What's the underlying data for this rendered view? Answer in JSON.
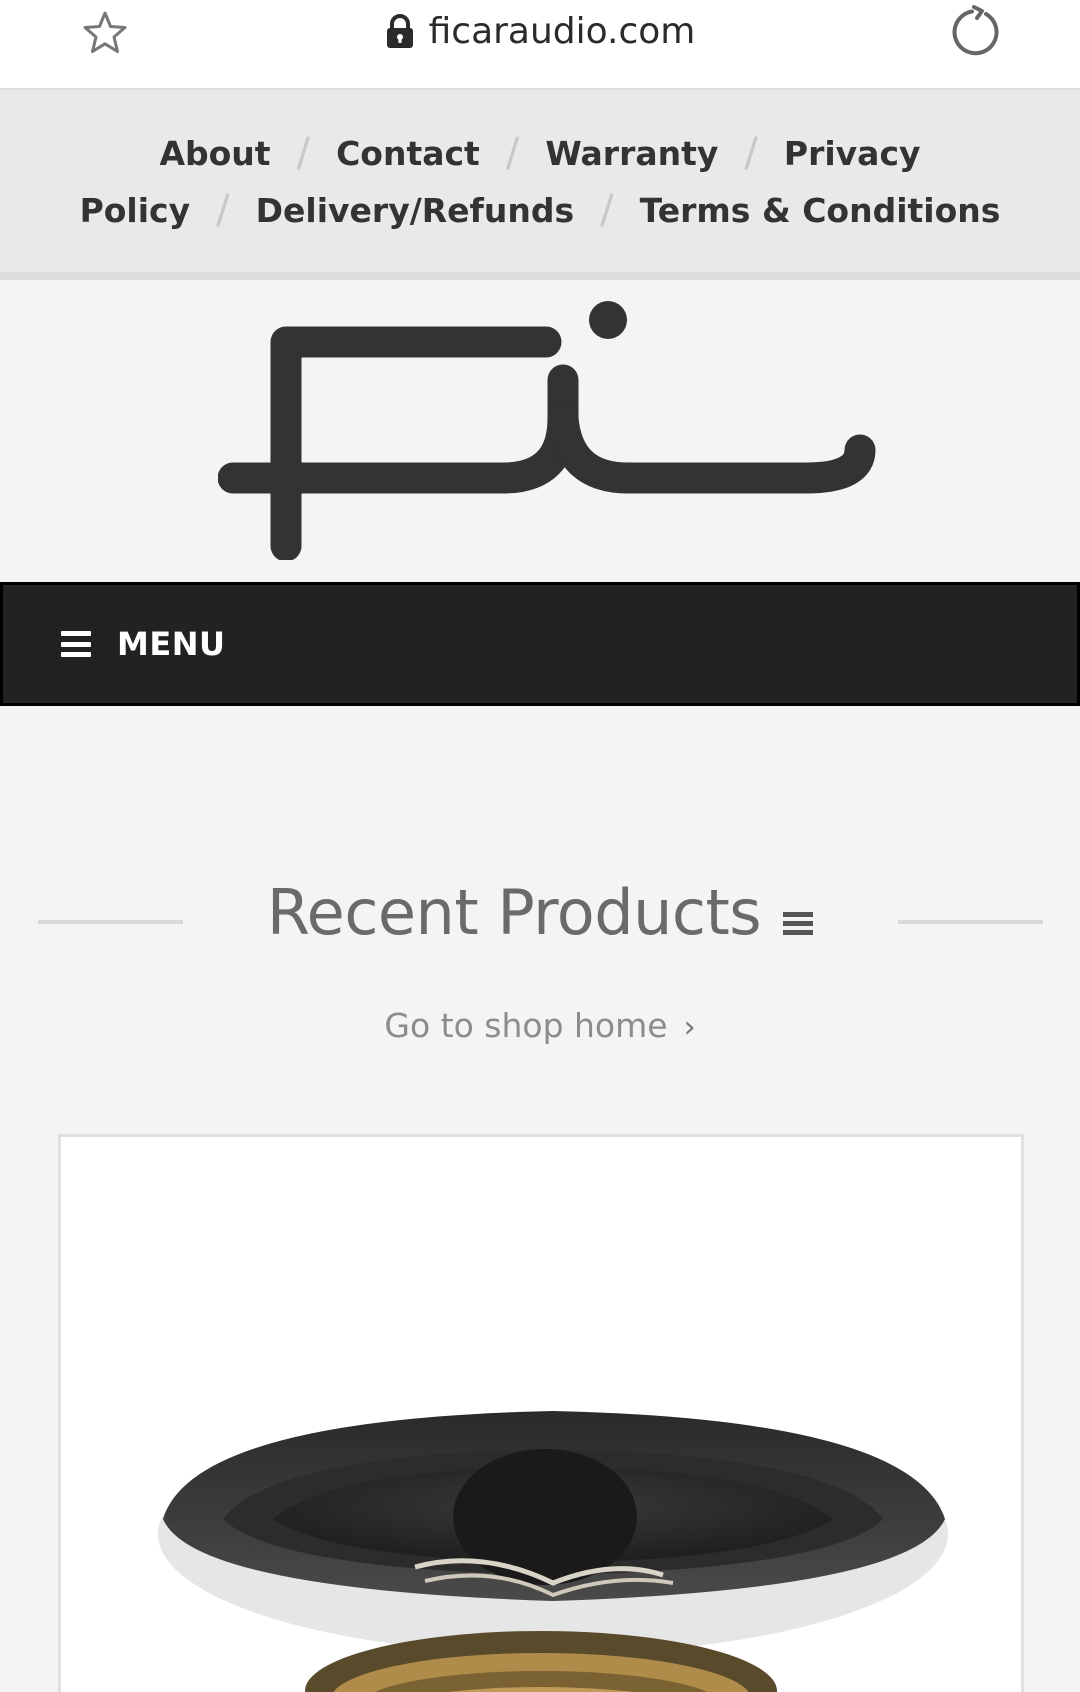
{
  "browser": {
    "url": "ficaraudio.com",
    "icons": {
      "bookmark": "star-outline-icon",
      "secure": "lock-icon",
      "reload": "reload-icon"
    }
  },
  "top_links": [
    {
      "label": "About"
    },
    {
      "label": "Contact"
    },
    {
      "label": "Warranty"
    },
    {
      "label": "Privacy"
    },
    {
      "label": "Policy"
    },
    {
      "label": "Delivery/Refunds"
    },
    {
      "label": "Terms & Conditions"
    }
  ],
  "logo": {
    "icon": "fi-logo-icon"
  },
  "menu": {
    "label": "MENU",
    "icon": "hamburger-icon"
  },
  "recent_products": {
    "title": "Recent Products",
    "shop_home_link": "Go to shop home",
    "chevron": "›"
  },
  "colors": {
    "menu_bar": "#222222",
    "top_bar": "#e9e9e9",
    "page_bg": "#f4f4f4",
    "title_text": "#6a6a6a"
  }
}
